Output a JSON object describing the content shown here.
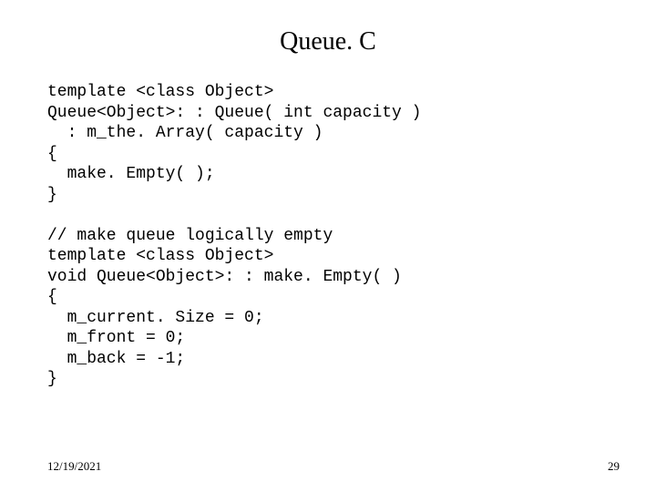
{
  "title": "Queue. C",
  "code_lines": [
    "template <class Object>",
    "Queue<Object>: : Queue( int capacity )",
    "  : m_the. Array( capacity )",
    "{",
    "  make. Empty( );",
    "}",
    "",
    "// make queue logically empty",
    "template <class Object>",
    "void Queue<Object>: : make. Empty( )",
    "{",
    "  m_current. Size = 0;",
    "  m_front = 0;",
    "  m_back = -1;",
    "}"
  ],
  "footer": {
    "date": "12/19/2021",
    "page": "29"
  }
}
